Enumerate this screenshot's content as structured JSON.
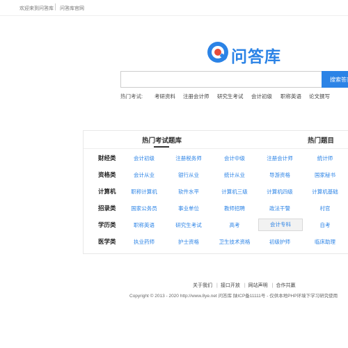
{
  "topbar": {
    "welcome": "欢迎来到问答库",
    "official": "问答库官网"
  },
  "logo": {
    "name": "问答库"
  },
  "search": {
    "placeholder": "",
    "button": "搜索答案"
  },
  "hot_search": {
    "label": "热门考试:",
    "keywords": [
      "考研资料",
      "注册会计师",
      "研究生考试",
      "会计初级",
      "职称英语",
      "论文撰写"
    ]
  },
  "panel": {
    "tabs": [
      "热门考试题库",
      "热门题目"
    ],
    "categories": [
      {
        "name": "财经类",
        "items": [
          "会计初级",
          "注册税务师",
          "会计中级",
          "注册会计师",
          "统计师"
        ]
      },
      {
        "name": "资格类",
        "items": [
          "会计从业",
          "银行从业",
          "统计从业",
          "导游资格",
          "国家秘书"
        ]
      },
      {
        "name": "计算机",
        "items": [
          "职称计算机",
          "软件水平",
          "计算机三级",
          "计算机四级",
          "计算机基础"
        ]
      },
      {
        "name": "招录类",
        "items": [
          "国家公务员",
          "事业单位",
          "教师招聘",
          "政法干警",
          "村官"
        ]
      },
      {
        "name": "学历类",
        "items": [
          "职称英语",
          "研究生考试",
          "高考",
          "会计专科",
          "自考"
        ]
      },
      {
        "name": "医学类",
        "items": [
          "执业药师",
          "护士资格",
          "卫生技术资格",
          "初级护师",
          "临床助理"
        ]
      }
    ],
    "active_item": "会计专科"
  },
  "footer": {
    "links": [
      "关于我们",
      "接口开放",
      "网站声明",
      "合作共赢"
    ],
    "copyright": "Copyright © 2013 - 2020 http://www.8ye.net  问答库  陕ICP备11111号 - 仅供本地PHP环境下学习研究使用"
  }
}
